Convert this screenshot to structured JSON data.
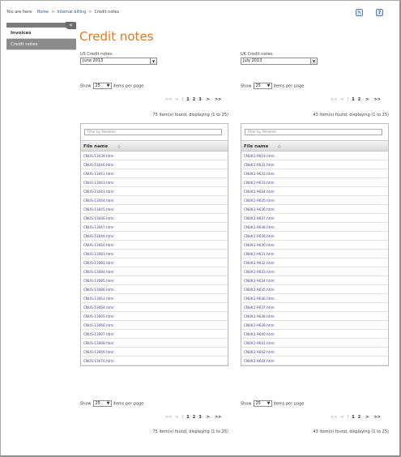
{
  "breadcrumb": {
    "prefix": "You are here:",
    "home": "Home",
    "billing": "Internal billing",
    "current": "Credit notes",
    "separator": ">"
  },
  "top_icons": {
    "first": "edit-page-icon",
    "second": "help-icon",
    "help_glyph": "?"
  },
  "sidebar": {
    "collapse_glyph": "«",
    "items": [
      {
        "label": "Invoices",
        "active": false
      },
      {
        "label": "Credit notes",
        "active": true
      }
    ]
  },
  "page_title": "Credit notes",
  "us": {
    "label": "US Credit notes:",
    "selected": "June 2013",
    "show_prefix": "Show",
    "page_size": "25",
    "show_suffix": "items per page",
    "pager_first": "<<",
    "pager_prev": "<",
    "pager_sep": "|",
    "pages": [
      "1",
      "2",
      "3"
    ],
    "current_page": "1",
    "pager_next": ">",
    "pager_last": ">>",
    "found": "75 item(s) found, displaying (1 to 25)",
    "filter_placeholder": "Filter by filename",
    "column": "File name",
    "sort_glyph": "◇",
    "files": [
      "CNUS-13039.html",
      "CNUS-13040.html",
      "CNUS-13041.html",
      "CNUS-13043.html",
      "CNUS-13043.html",
      "CNUS-13044.html",
      "CNUS-13045.html",
      "CNUS-13046.html",
      "CNUS-13047.html",
      "CNUS-13049.html",
      "CNUS-13050.html",
      "CNUS-13083.html",
      "CNUS-13083.html",
      "CNUS-13084.html",
      "CNUS-13085.html",
      "CNUS-13086.html",
      "CNUS-13063.html",
      "CNUS-13064.html",
      "CNUS-13065.html",
      "CNUS-13066.html",
      "CNUS-13067.html",
      "CNUS-13068.html",
      "CNUS-13069.html",
      "CNUS-13070.html"
    ]
  },
  "uk": {
    "label": "UK Credit notes:",
    "selected": "July 2013",
    "show_prefix": "Show",
    "page_size": "25",
    "show_suffix": "items per page",
    "pager_first": "<<",
    "pager_prev": "<",
    "pager_sep": "|",
    "pages": [
      "1",
      "2"
    ],
    "current_page": "1",
    "pager_next": ">",
    "pager_last": ">>",
    "found": "43 item(s) found, displaying (1 to 25)",
    "filter_placeholder": "Filter by filename",
    "column": "File name",
    "sort_glyph": "◇",
    "files": [
      "CNUK1-9619.html",
      "CNUK1-9631.html",
      "CNUK1-9633.html",
      "CNUK1-9633.html",
      "CNUK1-9634.html",
      "CNUK1-9635.html",
      "CNUK1-9636.html",
      "CNUK1-9637.html",
      "CNUK1-9638.html",
      "CNUK1-9639.html",
      "CNUK1-9630.html",
      "CNUK1-9631.html",
      "CNUK1-9632.html",
      "CNUK1-9633.html",
      "CNUK1-9634.html",
      "CNUK1-9635.html",
      "CNUK1-9636.html",
      "CNUK1-9637.html",
      "CNUK1-9638.html",
      "CNUK1-9639.html",
      "CNUK1-9640.html",
      "CNUK1-9641.html",
      "CNUK1-9642.html",
      "CNUK1-9644.html"
    ]
  }
}
